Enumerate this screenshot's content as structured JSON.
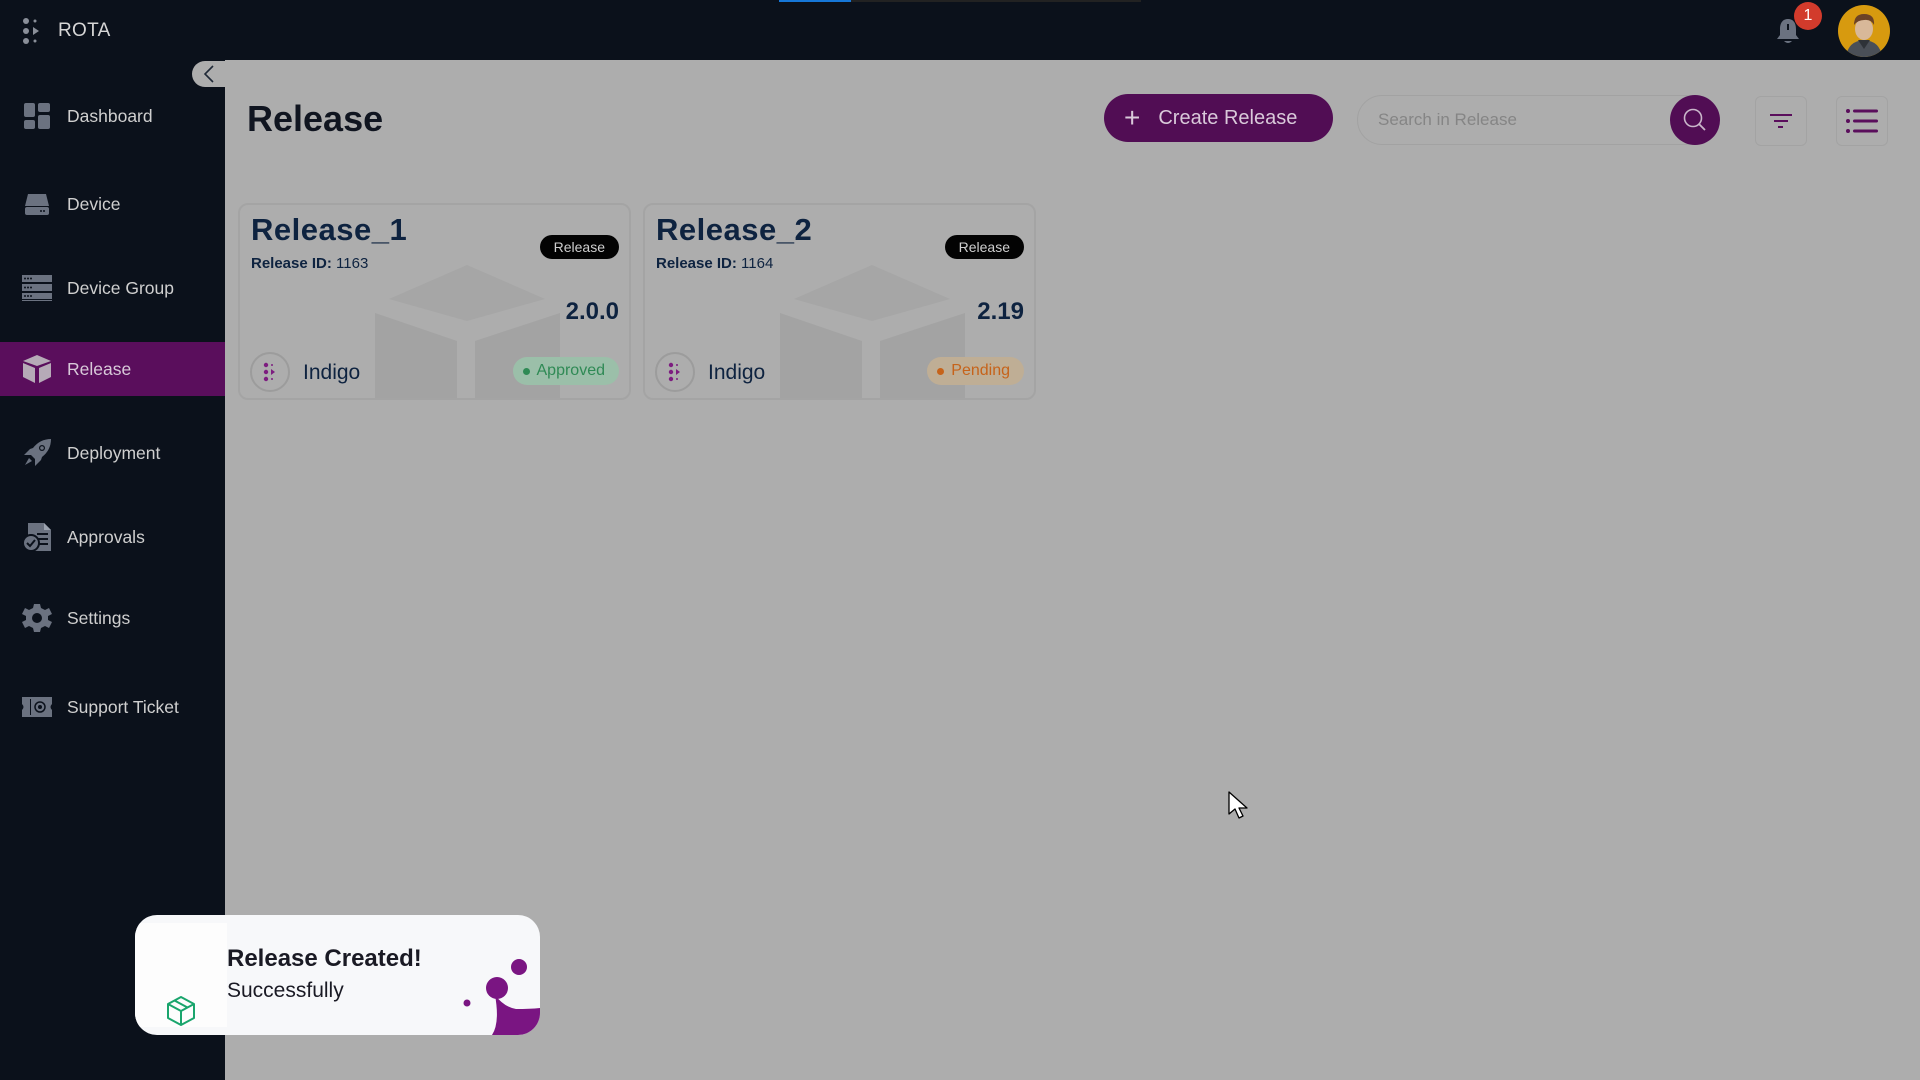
{
  "app": {
    "name": "ROTA",
    "page_load_progress_pct": 20
  },
  "header": {
    "notifications": {
      "icon": "bell-icon",
      "count": "1"
    },
    "avatar": {
      "icon": "user-avatar"
    }
  },
  "sidebar": {
    "collapse_icon": "chevron-left-icon",
    "items": [
      {
        "label": "Dashboard",
        "icon": "dashboard-grid-icon",
        "active": false
      },
      {
        "label": "Device",
        "icon": "hard-drive-icon",
        "active": false
      },
      {
        "label": "Device Group",
        "icon": "server-rack-icon",
        "active": false
      },
      {
        "label": "Release",
        "icon": "cube-icon",
        "active": true
      },
      {
        "label": "Deployment",
        "icon": "rocket-icon",
        "active": false
      },
      {
        "label": "Approvals",
        "icon": "document-check-icon",
        "active": false
      },
      {
        "label": "Settings",
        "icon": "gear-icon",
        "active": false
      },
      {
        "label": "Support Ticket",
        "icon": "ticket-icon",
        "active": false
      }
    ]
  },
  "main": {
    "title": "Release",
    "create_button": {
      "label": "Create Release",
      "icon": "plus-icon"
    },
    "search": {
      "placeholder": "Search in Release",
      "value": "",
      "icon": "search-icon"
    },
    "filter_icon": "filter-icon",
    "view_toggle_icon": "list-view-icon",
    "colors": {
      "accent": "#510d54",
      "active_nav": "#5a0e5c",
      "approved": "#2f8a55",
      "pending": "#c6631a"
    }
  },
  "releases": [
    {
      "name": "Release_1",
      "id_label": "Release ID:",
      "id": "1163",
      "tag": "Release",
      "version": "2.0.0",
      "org": "Indigo",
      "status": "Approved"
    },
    {
      "name": "Release_2",
      "id_label": "Release ID:",
      "id": "1164",
      "tag": "Release",
      "version": "2.19",
      "org": "Indigo",
      "status": "Pending"
    }
  ],
  "toast": {
    "title": "Release Created!",
    "message": "Successfully",
    "icon": "package-icon"
  }
}
